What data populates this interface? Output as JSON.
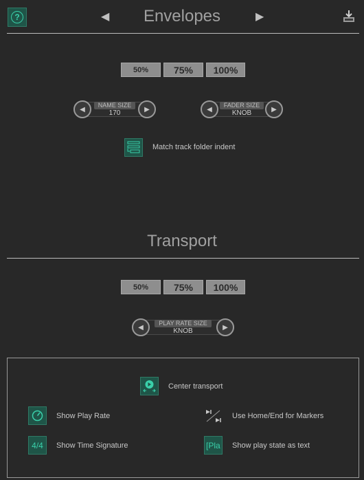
{
  "envelopes": {
    "title": "Envelopes",
    "help_label": "?",
    "scale_buttons": [
      "50%",
      "75%",
      "100%"
    ],
    "name_size": {
      "label": "NAME SIZE",
      "value": "170"
    },
    "fader_size": {
      "label": "FADER SIZE",
      "value": "KNOB"
    },
    "match_indent_label": "Match track folder indent"
  },
  "transport": {
    "title": "Transport",
    "scale_buttons": [
      "50%",
      "75%",
      "100%"
    ],
    "play_rate_size": {
      "label": "PLAY RATE SIZE",
      "value": "KNOB"
    },
    "options": {
      "center": "Center transport",
      "play_rate": "Show Play Rate",
      "home_end": "Use Home/End for Markers",
      "time_sig": "Show Time Signature",
      "time_sig_icon": "4/4",
      "play_state": "Show play state as text",
      "play_state_icon": "[Pla"
    }
  },
  "colors": {
    "accent": "#3ad0aa",
    "icon_bg": "#1f5548",
    "background": "#282828"
  }
}
